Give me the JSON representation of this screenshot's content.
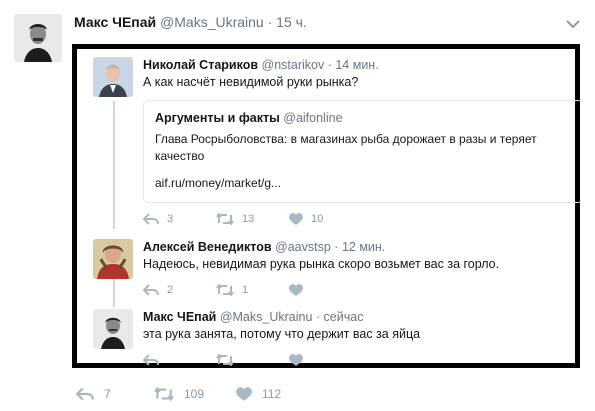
{
  "tweet": {
    "author_name": "Макс ЧЕпай",
    "handle": "@Maks_Ukrainu",
    "separator": "·",
    "time": "15 ч.",
    "actions": {
      "reply_count": "7",
      "retweet_count": "109",
      "like_count": "112"
    }
  },
  "thread": [
    {
      "author_name": "Николай Стариков",
      "handle": "@nstarikov",
      "separator": "·",
      "time": "14 мин.",
      "text": "А как насчёт невидимой руки рынка?",
      "card": {
        "source_name": "Аргументы и факты",
        "source_handle": "@aifonline",
        "description": "Глава Росрыболовства: в магазинах рыба дорожает в разы и теряет качество",
        "link": "aif.ru/money/market/g..."
      },
      "actions": {
        "reply_count": "3",
        "retweet_count": "13",
        "like_count": "10"
      }
    },
    {
      "author_name": "Алексей Венедиктов",
      "handle": "@aavstsp",
      "separator": "·",
      "time": "12 мин.",
      "text": "Надеюсь, невидимая рука рынка скоро возьмет вас за горло.",
      "actions": {
        "reply_count": "2",
        "retweet_count": "1",
        "like_count": ""
      }
    },
    {
      "author_name": "Макс ЧЕпай",
      "handle": "@Maks_Ukrainu",
      "separator": "·",
      "time": "сейчас",
      "text": "эта рука занята, потому что держит вас за яйца",
      "actions": {
        "reply_count": "",
        "retweet_count": "",
        "like_count": ""
      }
    }
  ],
  "colors": {
    "muted": "#657786",
    "icon": "#aab8c2",
    "frame": "#000000",
    "line": "#ccd6dd"
  },
  "icons": [
    "reply-icon",
    "retweet-icon",
    "like-icon",
    "chevron-down-icon",
    "avatar"
  ]
}
